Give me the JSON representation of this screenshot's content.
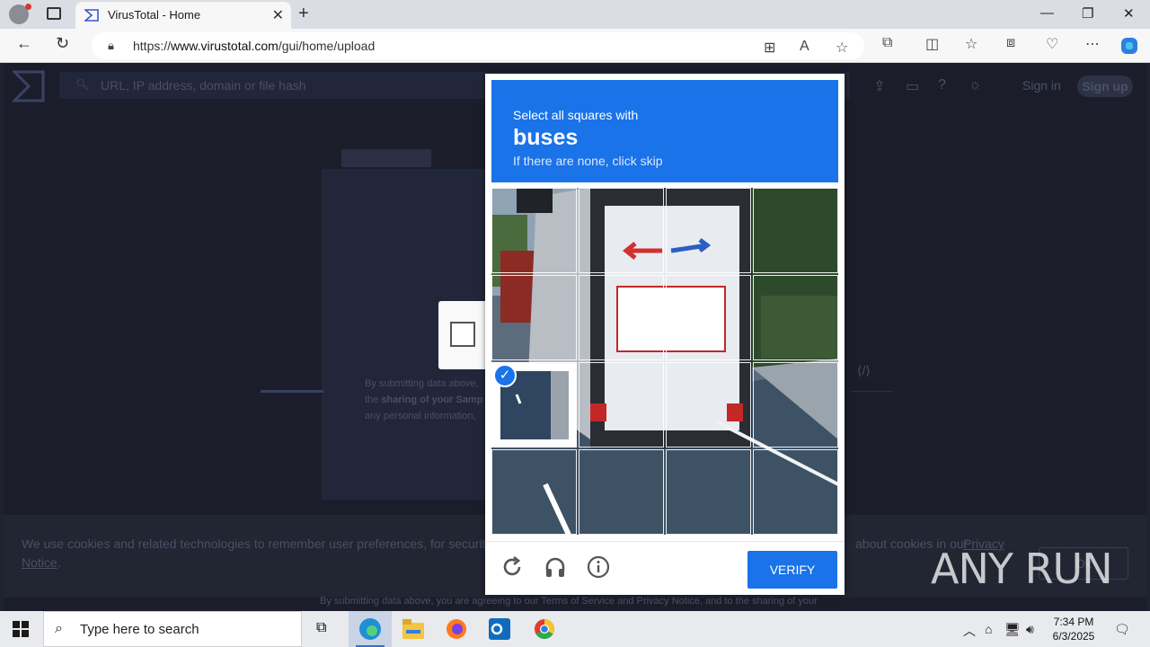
{
  "browser": {
    "tab_title": "VirusTotal - Home",
    "url_prefix": "https://",
    "url_domain": "www.virustotal.com",
    "url_path": "/gui/home/upload"
  },
  "virustotal": {
    "search_placeholder": "URL, IP address, domain or file hash",
    "sign_in": "Sign in",
    "sign_up": "Sign up",
    "submit_text_1": "By submitting data above,",
    "submit_text_2a": "the ",
    "submit_text_2b": "sharing of your Samp",
    "submit_text_3": "any personal information,",
    "cookie_text": "We use cookies and related technologies to remember user preferences, for security, to",
    "cookie_text_end": "about cookies in our",
    "cookie_link_1": "Privacy",
    "cookie_link_2": "Notice",
    "cookie_button": "Ok",
    "footer_text": "By submitting data above, you are agreeing to our Terms of Service and Privacy Notice, and to the sharing of your"
  },
  "captcha": {
    "prompt_line1": "Select all squares with",
    "prompt_subject": "buses",
    "prompt_line3": "If there are none, click skip",
    "verify_label": "VERIFY",
    "selected_cells": [
      [
        2,
        0
      ]
    ],
    "icons": [
      "refresh-icon",
      "audio-icon",
      "info-icon"
    ]
  },
  "taskbar": {
    "search_placeholder": "Type here to search",
    "time": "7:34 PM",
    "date": "6/3/2025"
  },
  "watermark": "ANY RUN"
}
